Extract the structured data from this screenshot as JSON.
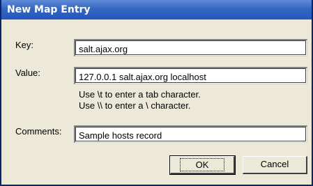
{
  "window": {
    "title": "New Map Entry"
  },
  "form": {
    "key_label": "Key:",
    "key_value": "salt.ajax.org",
    "value_label": "Value:",
    "value_value": "127.0.0.1 salt.ajax.org localhost",
    "hint_line1": "Use \\t to enter a tab character.",
    "hint_line2": "Use \\\\ to enter a \\ character.",
    "comments_label": "Comments:",
    "comments_value": "Sample hosts record"
  },
  "buttons": {
    "ok_label": "OK",
    "cancel_label": "Cancel"
  },
  "colors": {
    "titlebar": "#2456bd",
    "dialog_bg": "#ece9d8"
  }
}
